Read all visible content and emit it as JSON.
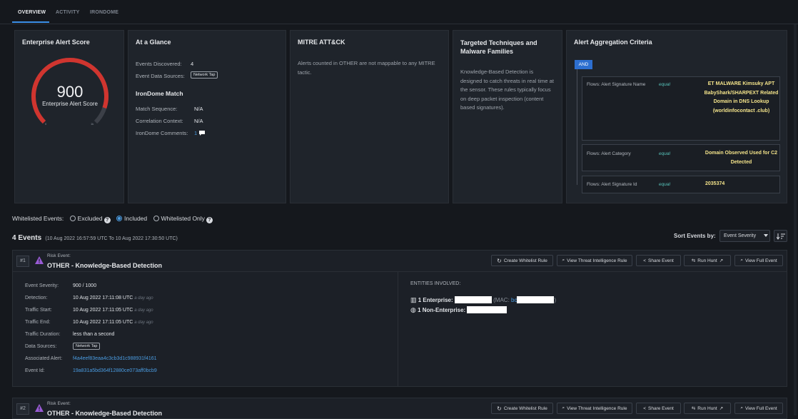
{
  "tabs": [
    "OVERVIEW",
    "ACTIVITY",
    "IRONDOME"
  ],
  "score_card": {
    "title": "Enterprise Alert Score",
    "score": "900",
    "label": "Enterprise Alert Score",
    "min": "0",
    "max": "1k",
    "fraction": 0.9
  },
  "glance": {
    "title": "At a Glance",
    "events_discovered_label": "Events Discovered:",
    "events_discovered": "4",
    "data_sources_label": "Event Data Sources:",
    "data_source_tag": "Network Tap",
    "irondome_title": "IronDome Match",
    "match_sequence_label": "Match Sequence:",
    "match_sequence": "N/A",
    "correlation_label": "Correlation Context:",
    "correlation": "N/A",
    "comments_label": "IronDome Comments:",
    "comments": "1"
  },
  "mitre": {
    "title": "MITRE ATT&CK",
    "text": "Alerts counted in OTHER are not mappable to any MITRE tactic."
  },
  "targeted": {
    "title": "Targeted Techniques and Malware Families",
    "text": "Knowledge-Based Detection is designed to catch threats in real time at the sensor. These rules typically focus on deep packet inspection (content based signatures)."
  },
  "criteria": {
    "title": "Alert Aggregation Criteria",
    "operator": "AND",
    "rows": [
      {
        "field": "Flows: Alert Signature Name",
        "op": "equal",
        "value": "ET MALWARE Kimsuky APT BabyShark/SHARPEXT Related Domain in DNS Lookup (worldinfocontact .club)"
      },
      {
        "field": "Flows: Alert Category",
        "op": "equal",
        "value": "Domain Observed Used for C2 Detected"
      },
      {
        "field": "Flows: Alert Signature Id",
        "op": "equal",
        "value": "2035374"
      }
    ]
  },
  "filter": {
    "label": "Whitelisted Events:",
    "options": [
      "Excluded",
      "Included",
      "Whitelisted Only"
    ],
    "selected": "Included"
  },
  "events_header": {
    "count": "4 Events",
    "range": "(10 Aug 2022 16:57:59 UTC To 10 Aug 2022 17:30:50 UTC)",
    "sort_label": "Sort Events by:",
    "sort_value": "Event Severity"
  },
  "buttons": {
    "create_whitelist": "Create Whitelist Rule",
    "threat_intel": "View Threat Intelligence Rule",
    "share": "Share Event",
    "run_hunt": "Run Hunt",
    "full_event": "View Full Event"
  },
  "event1": {
    "number": "#1",
    "type": "Risk Event:",
    "name": "OTHER - Knowledge-Based Detection",
    "severity_label": "Event Severity:",
    "severity": "900 / 1000",
    "detection_label": "Detection:",
    "detection": "10 Aug 2022 17:11:08 UTC",
    "traffic_start_label": "Traffic Start:",
    "traffic_start": "10 Aug 2022 17:11:05 UTC",
    "traffic_end_label": "Traffic End:",
    "traffic_end": "10 Aug 2022 17:11:05 UTC",
    "ago": "a day ago",
    "duration_label": "Traffic Duration:",
    "duration": "less than a second",
    "sources_label": "Data Sources:",
    "source_tag": "Network Tap",
    "assoc_label": "Associated Alert:",
    "assoc": "f4a4eef83eaa4c3cb3d1c988931f4161",
    "event_id_label": "Event Id:",
    "event_id": "19a831a5bd364f12880ce073aff0bcb9",
    "entities_title": "ENTITIES INVOLVED:",
    "enterprise": "1 Enterprise:",
    "mac_prefix": "(MAC:",
    "mac_value": "bc",
    "non_enterprise": "1 Non-Enterprise:"
  },
  "event2": {
    "number": "#2",
    "type": "Risk Event:",
    "name": "OTHER - Knowledge-Based Detection"
  }
}
